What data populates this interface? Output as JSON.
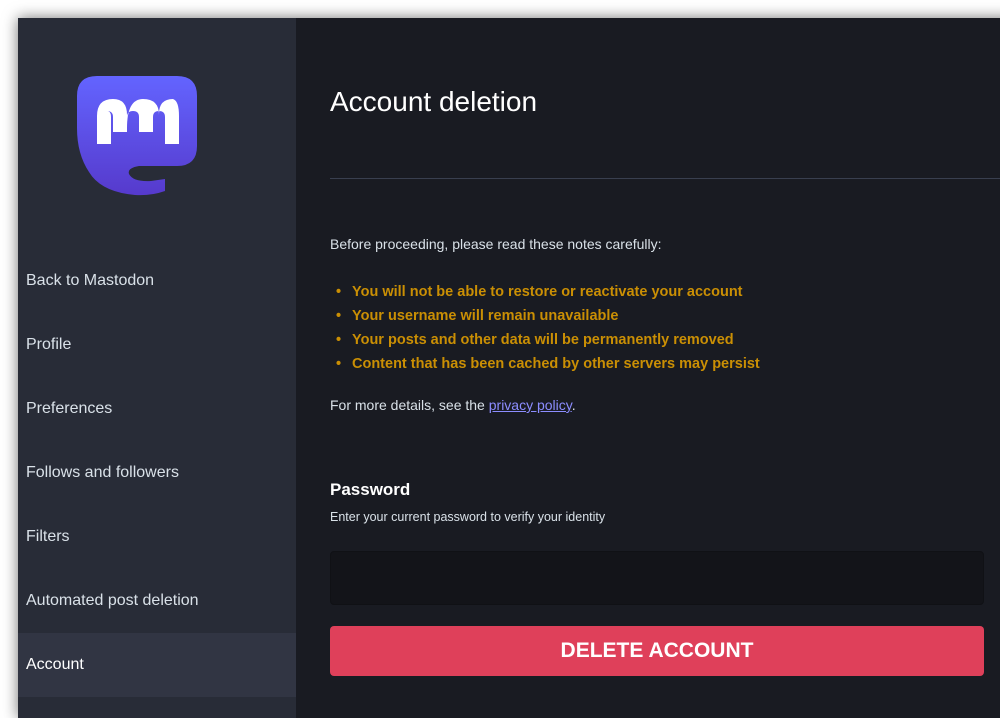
{
  "colors": {
    "sidebar_bg": "#282c37",
    "main_bg": "#191b22",
    "warning": "#ca8f04",
    "link": "#8c8dff",
    "danger": "#df405a",
    "logo_gradient": [
      "#6364ff",
      "#563acc"
    ]
  },
  "sidebar": {
    "logo_icon": "mastodon-logo-icon",
    "items": [
      {
        "label": "Back to Mastodon",
        "active": false
      },
      {
        "label": "Profile",
        "active": false
      },
      {
        "label": "Preferences",
        "active": false
      },
      {
        "label": "Follows and followers",
        "active": false
      },
      {
        "label": "Filters",
        "active": false
      },
      {
        "label": "Automated post deletion",
        "active": false
      },
      {
        "label": "Account",
        "active": true
      }
    ]
  },
  "main": {
    "title": "Account deletion",
    "intro": "Before proceeding, please read these notes carefully:",
    "warnings": [
      "You will not be able to restore or reactivate your account",
      "Your username will remain unavailable",
      "Your posts and other data will be permanently removed",
      "Content that has been cached by other servers may persist"
    ],
    "details_prefix": "For more details, see the ",
    "details_link": "privacy policy",
    "details_suffix": ".",
    "password": {
      "label": "Password",
      "hint": "Enter your current password to verify your identity",
      "value": "",
      "placeholder": ""
    },
    "delete_button": "DELETE ACCOUNT"
  }
}
